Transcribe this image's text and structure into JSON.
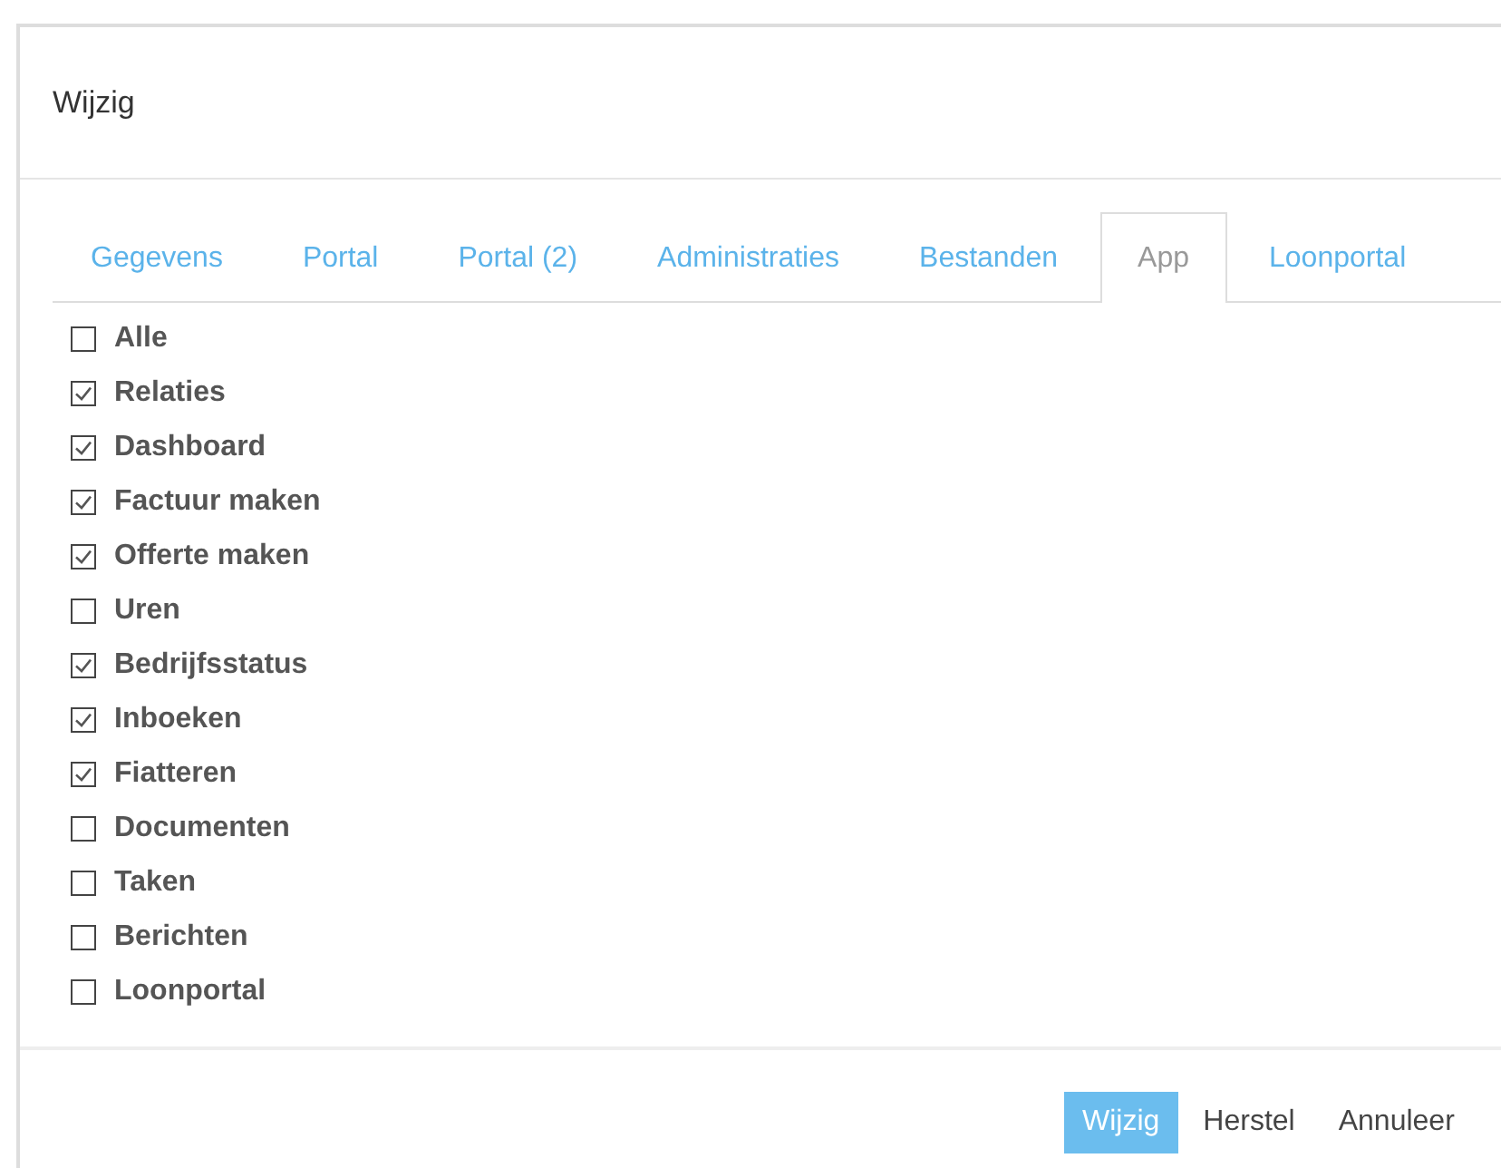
{
  "dialog": {
    "title": "Wijzig"
  },
  "tabs": [
    {
      "label": "Gegevens",
      "selected": false
    },
    {
      "label": "Portal",
      "selected": false
    },
    {
      "label": "Portal (2)",
      "selected": false
    },
    {
      "label": "Administraties",
      "selected": false
    },
    {
      "label": "Bestanden",
      "selected": false
    },
    {
      "label": "App",
      "selected": true
    },
    {
      "label": "Loonportal",
      "selected": false
    }
  ],
  "options": [
    {
      "label": "Alle",
      "checked": false
    },
    {
      "label": "Relaties",
      "checked": true
    },
    {
      "label": "Dashboard",
      "checked": true
    },
    {
      "label": "Factuur maken",
      "checked": true
    },
    {
      "label": "Offerte maken",
      "checked": true
    },
    {
      "label": "Uren",
      "checked": false
    },
    {
      "label": "Bedrijfsstatus",
      "checked": true
    },
    {
      "label": "Inboeken",
      "checked": true
    },
    {
      "label": "Fiatteren",
      "checked": true
    },
    {
      "label": "Documenten",
      "checked": false
    },
    {
      "label": "Taken",
      "checked": false
    },
    {
      "label": "Berichten",
      "checked": false
    },
    {
      "label": "Loonportal",
      "checked": false
    }
  ],
  "buttons": [
    {
      "label": "Wijzig",
      "kind": "primary"
    },
    {
      "label": "Herstel",
      "kind": "plain"
    },
    {
      "label": "Annuleer",
      "kind": "plain"
    }
  ]
}
